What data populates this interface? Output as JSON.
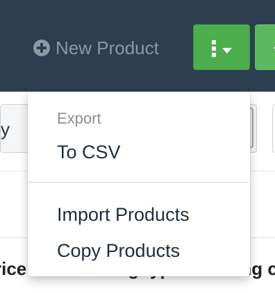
{
  "topbar": {
    "new_product_label": "New Product",
    "actions_menu_icon": "vertical-dots-icon",
    "actions_caret_icon": "caret-down-icon",
    "second_button_icon": "chevron-left-icon",
    "colors": {
      "bar_background": "#2c3e50",
      "button_green": "#4cae4c",
      "muted_text": "#8c98a5"
    }
  },
  "filter": {
    "select_text": "y"
  },
  "table_header": {
    "columns": [
      "rice",
      "Pricing type",
      "Pricing c"
    ]
  },
  "dropdown_menu": {
    "export_caption": "Export",
    "items": [
      {
        "label": "To CSV"
      },
      {
        "label": "Import Products"
      },
      {
        "label": "Copy Products"
      }
    ]
  }
}
